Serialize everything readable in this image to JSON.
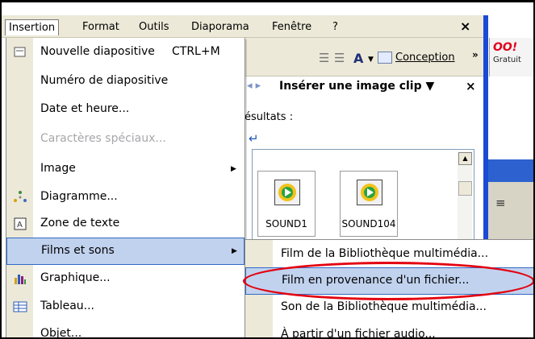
{
  "menubar": {
    "items": [
      {
        "label": "Insertion",
        "active": true
      },
      {
        "label": "Format"
      },
      {
        "label": "Outils"
      },
      {
        "label": "Diaporama"
      },
      {
        "label": "Fenêtre"
      },
      {
        "label": "?"
      }
    ],
    "close": "×"
  },
  "toolbar": {
    "font_glyph": "A",
    "conception": "Conception",
    "chevron": "»"
  },
  "yahoo": {
    "logo": "OO!",
    "gratuit": "Gratuit"
  },
  "task_pane": {
    "title": "Insérer une image clip ▼",
    "close": "×",
    "results_label": "ésultats :",
    "clips": [
      {
        "label": "SOUND1"
      },
      {
        "label": "SOUND104"
      }
    ]
  },
  "menu": {
    "items": [
      {
        "label": "Nouvelle diapositive",
        "shortcut": "CTRL+M",
        "icon": "new-slide-icon"
      },
      {
        "label": "Numéro de diapositive"
      },
      {
        "label": "Date et heure..."
      },
      {
        "label": "Caractères spéciaux...",
        "disabled": true
      },
      {
        "label": "Image",
        "submenu": true
      },
      {
        "label": "Diagramme...",
        "icon": "diagram-icon"
      },
      {
        "label": "Zone de texte",
        "icon": "textbox-icon"
      },
      {
        "label": "Films et sons",
        "submenu": true,
        "highlighted": true
      },
      {
        "label": "Graphique...",
        "icon": "chart-icon"
      },
      {
        "label": "Tableau...",
        "icon": "table-icon"
      },
      {
        "label": "Objet..."
      }
    ]
  },
  "submenu": {
    "items": [
      {
        "label": "Film de la Bibliothèque multimédia..."
      },
      {
        "label": "Film en provenance d'un fichier...",
        "highlighted": true
      },
      {
        "label": "Son de la Bibliothèque multimédia..."
      },
      {
        "label": "À partir d'un fichier audio..."
      }
    ]
  },
  "colors": {
    "highlight_bg": "#c1d2ee",
    "highlight_border": "#316ac5",
    "annotation_red": "#e3000f",
    "taskpane_blue": "#1a4bd4"
  }
}
